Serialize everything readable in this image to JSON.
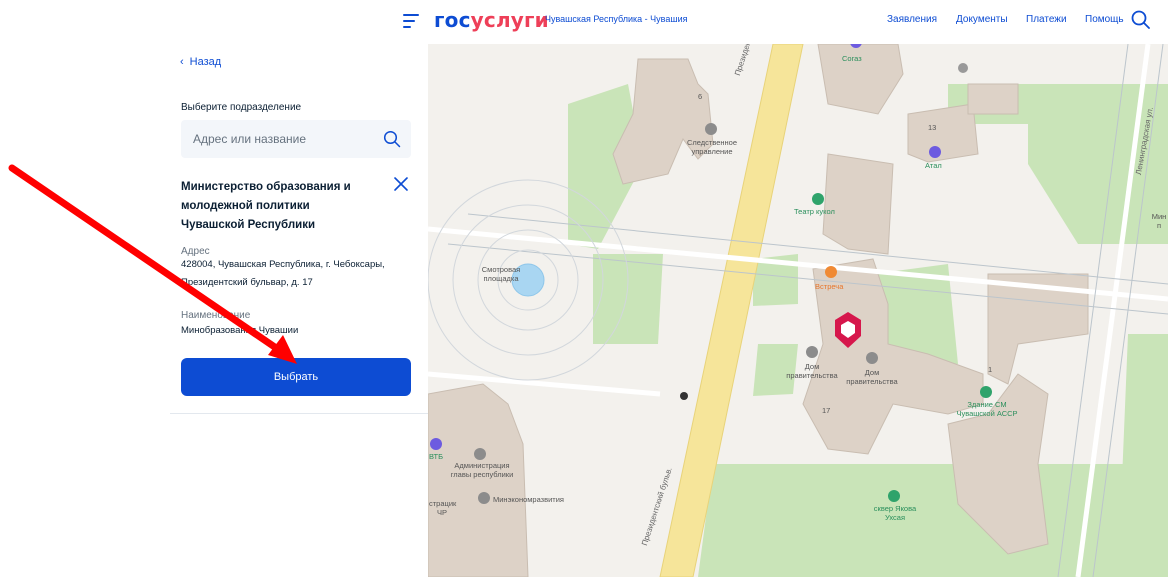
{
  "header": {
    "logo_part1": "гос",
    "logo_part2": "услуги",
    "region": "Чувашская Республика - Чувашия",
    "nav": [
      "Заявления",
      "Документы",
      "Платежи",
      "Помощь"
    ]
  },
  "panel": {
    "back_label": "Назад",
    "select_division_label": "Выберите подразделение",
    "search_placeholder": "Адрес или название",
    "org_name": "Министерство образования и молодежной политики Чувашской Республики",
    "address_label": "Адрес",
    "address_value": "428004, Чувашская Республика, г. Чебоксары, Президентский бульвар, д. 17",
    "name_label": "Наименование",
    "name_value": "Минобразования Чувашии",
    "select_button": "Выбрать"
  },
  "map": {
    "labels": {
      "sogaz": "Согаз",
      "house_6": "6",
      "investigative": "Следственное управление",
      "house_13": "13",
      "atal": "Атал",
      "puppet_theater": "Театр кукол",
      "observation": "Смотровая площадка",
      "vstrecha": "Встреча",
      "gov_house_1": "Дом правительства",
      "gov_house_2": "Дом правительства",
      "house_1": "1",
      "building_cm": "Здание СМ Чувашской АССР",
      "house_17": "17",
      "vtb": "ВТБ",
      "administration": "Администрация главы республики",
      "administration_cut": "страцик ЧР",
      "mineconom": "Минэкономразвития",
      "square": "сквер Якова Ухсая",
      "presidential_top": "Президентск",
      "presidential_bottom": "Президентский бульв.",
      "leningradskaya": "Ленинградская ул.",
      "min_cut": "Мин п"
    }
  },
  "colors": {
    "brand_blue": "#0d4cd3",
    "brand_red": "#ee3f58",
    "arrow_red": "#ff0000",
    "marker": "#d6174c"
  }
}
